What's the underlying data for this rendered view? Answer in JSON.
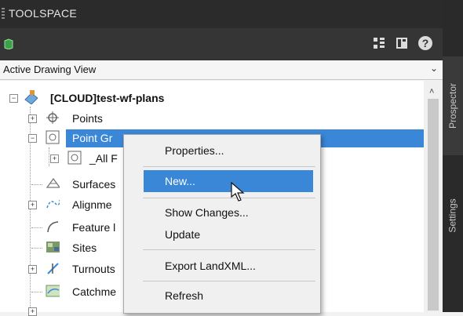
{
  "panel": {
    "title": "TOOLSPACE"
  },
  "toolbar": {
    "icons": [
      "cube-icon",
      "tree-view-icon",
      "panel-icon",
      "help-icon"
    ],
    "help_glyph": "?"
  },
  "view_dropdown": {
    "value": "Active Drawing View"
  },
  "tabs": {
    "prospector": "Prospector",
    "settings": "Settings"
  },
  "tree": {
    "root": "[CLOUD]test-wf-plans",
    "items": [
      {
        "label": "Points",
        "icon": "points-icon"
      },
      {
        "label": "Point Gr",
        "icon": "point-groups-icon",
        "selected": true
      },
      {
        "label": "_All F",
        "icon": "point-group-icon"
      },
      {
        "label": "Surfaces",
        "icon": "surfaces-icon"
      },
      {
        "label": "Alignme",
        "icon": "alignments-icon"
      },
      {
        "label": "Feature l",
        "icon": "feature-lines-icon"
      },
      {
        "label": "Sites",
        "icon": "sites-icon"
      },
      {
        "label": "Turnouts",
        "icon": "turnouts-icon"
      },
      {
        "label": "Catchme",
        "icon": "catchments-icon"
      }
    ]
  },
  "context_menu": {
    "items": [
      "Properties...",
      "New...",
      "Show Changes...",
      "Update",
      "Export LandXML...",
      "Refresh"
    ],
    "highlighted": "New..."
  },
  "colors": {
    "selection": "#3a87d8",
    "titlebar": "#2b2b2b",
    "toolbar": "#353535"
  }
}
